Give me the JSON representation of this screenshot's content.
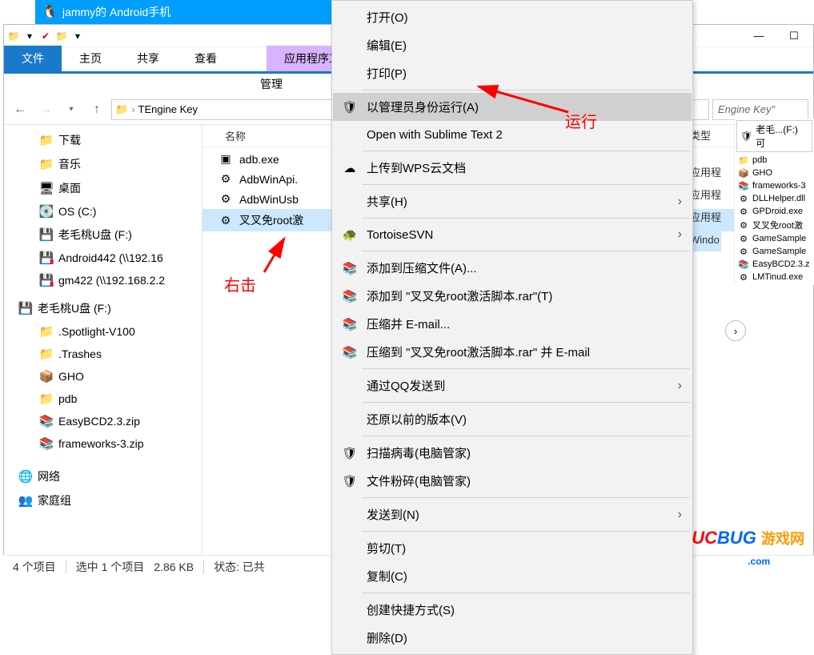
{
  "qq_title": "jammy的 Android手机",
  "ribbon": {
    "file": "文件",
    "home": "主页",
    "share": "共享",
    "view": "查看",
    "context": "应用程序工具",
    "manage": "管理"
  },
  "breadcrumb": {
    "sep": "›",
    "part": "TEngine Key"
  },
  "search_hint": "Engine Key\"",
  "tree": [
    {
      "icon": "📁",
      "label": "下载",
      "cls": "folder-icon"
    },
    {
      "icon": "📁",
      "label": "音乐",
      "cls": "folder-icon"
    },
    {
      "icon": "🖥",
      "label": "桌面",
      "cls": ""
    },
    {
      "icon": "💽",
      "label": "OS (C:)",
      "cls": "drive-icon"
    },
    {
      "icon": "💾",
      "label": "老毛桃U盘 (F:)",
      "cls": "drive-usb"
    },
    {
      "icon": "💾",
      "label": "Android442 (\\\\192.16",
      "cls": "drive-x"
    },
    {
      "icon": "💾",
      "label": "gm422 (\\\\192.168.2.2",
      "cls": "drive-x"
    }
  ],
  "tree_group_header": "老毛桃U盘 (F:)",
  "tree_group": [
    {
      "icon": "📁",
      "label": ".Spotlight-V100"
    },
    {
      "icon": "📁",
      "label": ".Trashes"
    },
    {
      "icon": "📦",
      "label": "GHO"
    },
    {
      "icon": "📁",
      "label": "pdb"
    },
    {
      "icon": "📚",
      "label": "EasyBCD2.3.zip"
    },
    {
      "icon": "📚",
      "label": "frameworks-3.zip"
    }
  ],
  "tree_footer": [
    {
      "icon": "🌐",
      "label": "网络"
    },
    {
      "icon": "👥",
      "label": "家庭组"
    }
  ],
  "col_name": "名称",
  "col_type": "类型",
  "files": [
    {
      "icon": "▣",
      "name": "adb.exe",
      "type": "应用程"
    },
    {
      "icon": "⚙",
      "name": "AdbWinApi.",
      "type": "应用程"
    },
    {
      "icon": "⚙",
      "name": "AdbWinUsb",
      "type": "应用程"
    },
    {
      "icon": "⚙",
      "name": "叉叉免root激",
      "type": "Windo",
      "selected": true
    }
  ],
  "menu": [
    {
      "label": "打开(O)",
      "icon": ""
    },
    {
      "label": "编辑(E)",
      "icon": ""
    },
    {
      "label": "打印(P)",
      "icon": ""
    },
    {
      "sep": true
    },
    {
      "label": "以管理员身份运行(A)",
      "icon": "🛡",
      "highlighted": true
    },
    {
      "label": "Open with Sublime Text 2",
      "icon": ""
    },
    {
      "sep": true
    },
    {
      "label": "上传到WPS云文档",
      "icon": "☁"
    },
    {
      "sep": true
    },
    {
      "label": "共享(H)",
      "icon": "",
      "arrow": true
    },
    {
      "sep": true
    },
    {
      "label": "TortoiseSVN",
      "icon": "🐢",
      "arrow": true
    },
    {
      "sep": true
    },
    {
      "label": "添加到压缩文件(A)...",
      "icon": "📚"
    },
    {
      "label": "添加到 \"叉叉免root激活脚本.rar\"(T)",
      "icon": "📚"
    },
    {
      "label": "压缩并 E-mail...",
      "icon": "📚"
    },
    {
      "label": "压缩到 \"叉叉免root激活脚本.rar\" 并 E-mail",
      "icon": "📚"
    },
    {
      "sep": true
    },
    {
      "label": "通过QQ发送到",
      "icon": "",
      "arrow": true
    },
    {
      "sep": true
    },
    {
      "label": "还原以前的版本(V)",
      "icon": ""
    },
    {
      "sep": true
    },
    {
      "label": "扫描病毒(电脑管家)",
      "icon": "🛡"
    },
    {
      "label": "文件粉碎(电脑管家)",
      "icon": "🛡"
    },
    {
      "sep": true
    },
    {
      "label": "发送到(N)",
      "icon": "",
      "arrow": true
    },
    {
      "sep": true
    },
    {
      "label": "剪切(T)",
      "icon": ""
    },
    {
      "label": "复制(C)",
      "icon": ""
    },
    {
      "sep": true
    },
    {
      "label": "创建快捷方式(S)",
      "icon": ""
    },
    {
      "label": "删除(D)",
      "icon": ""
    }
  ],
  "preview_title": "老毛...(F:) 可",
  "preview": [
    {
      "icon": "📁",
      "label": "pdb"
    },
    {
      "icon": "📦",
      "label": "GHO"
    },
    {
      "icon": "📚",
      "label": "frameworks-3"
    },
    {
      "icon": "⚙",
      "label": "DLLHelper.dll"
    },
    {
      "icon": "⚙",
      "label": "GPDroid.exe"
    },
    {
      "icon": "⚙",
      "label": "叉叉免root激"
    },
    {
      "icon": "⚙",
      "label": "GameSample"
    },
    {
      "icon": "⚙",
      "label": "GameSample"
    },
    {
      "icon": "📚",
      "label": "EasyBCD2.3.z"
    },
    {
      "icon": "⚙",
      "label": "LMTinud.exe"
    }
  ],
  "status": {
    "items": "4 个项目",
    "selected": "选中 1 个项目",
    "size": "2.86 KB",
    "state": "状态: 已共"
  },
  "annotations": {
    "rightclick": "右击",
    "run": "运行"
  },
  "watermark": {
    "uc": "UC",
    "bug": "BUG",
    "cn": "游戏网",
    "com": ".com"
  }
}
